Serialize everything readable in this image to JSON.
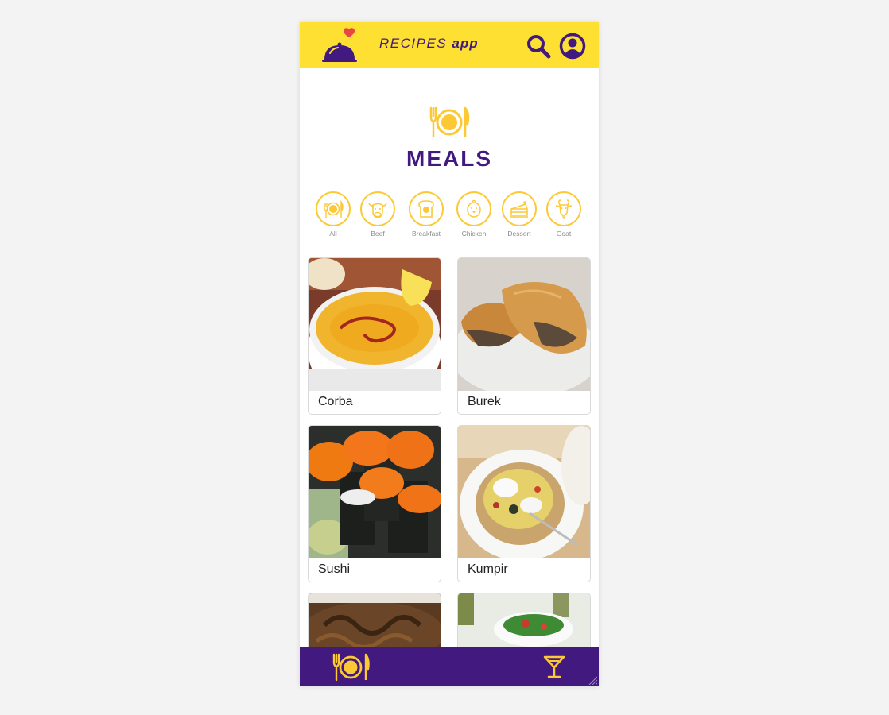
{
  "header": {
    "title_main": "RECIPES",
    "title_app": "app",
    "logo_icon": "cloche-heart-icon",
    "search_icon": "search-icon",
    "profile_icon": "profile-icon"
  },
  "page": {
    "title": "MEALS",
    "icon": "plate-cutlery-icon"
  },
  "categories": [
    {
      "label": "All",
      "icon": "plate-icon"
    },
    {
      "label": "Beef",
      "icon": "cow-icon"
    },
    {
      "label": "Breakfast",
      "icon": "toast-icon"
    },
    {
      "label": "Chicken",
      "icon": "chicken-icon"
    },
    {
      "label": "Dessert",
      "icon": "cake-icon"
    },
    {
      "label": "Goat",
      "icon": "goat-icon"
    }
  ],
  "meals": [
    {
      "name": "Corba"
    },
    {
      "name": "Burek"
    },
    {
      "name": "Sushi"
    },
    {
      "name": "Kumpir"
    },
    {
      "name": ""
    },
    {
      "name": ""
    }
  ],
  "footer": {
    "meals_icon": "plate-cutlery-icon",
    "drinks_icon": "cocktail-icon"
  },
  "colors": {
    "yellow": "#fde031",
    "purple": "#41197f",
    "gold": "#fcc934"
  }
}
